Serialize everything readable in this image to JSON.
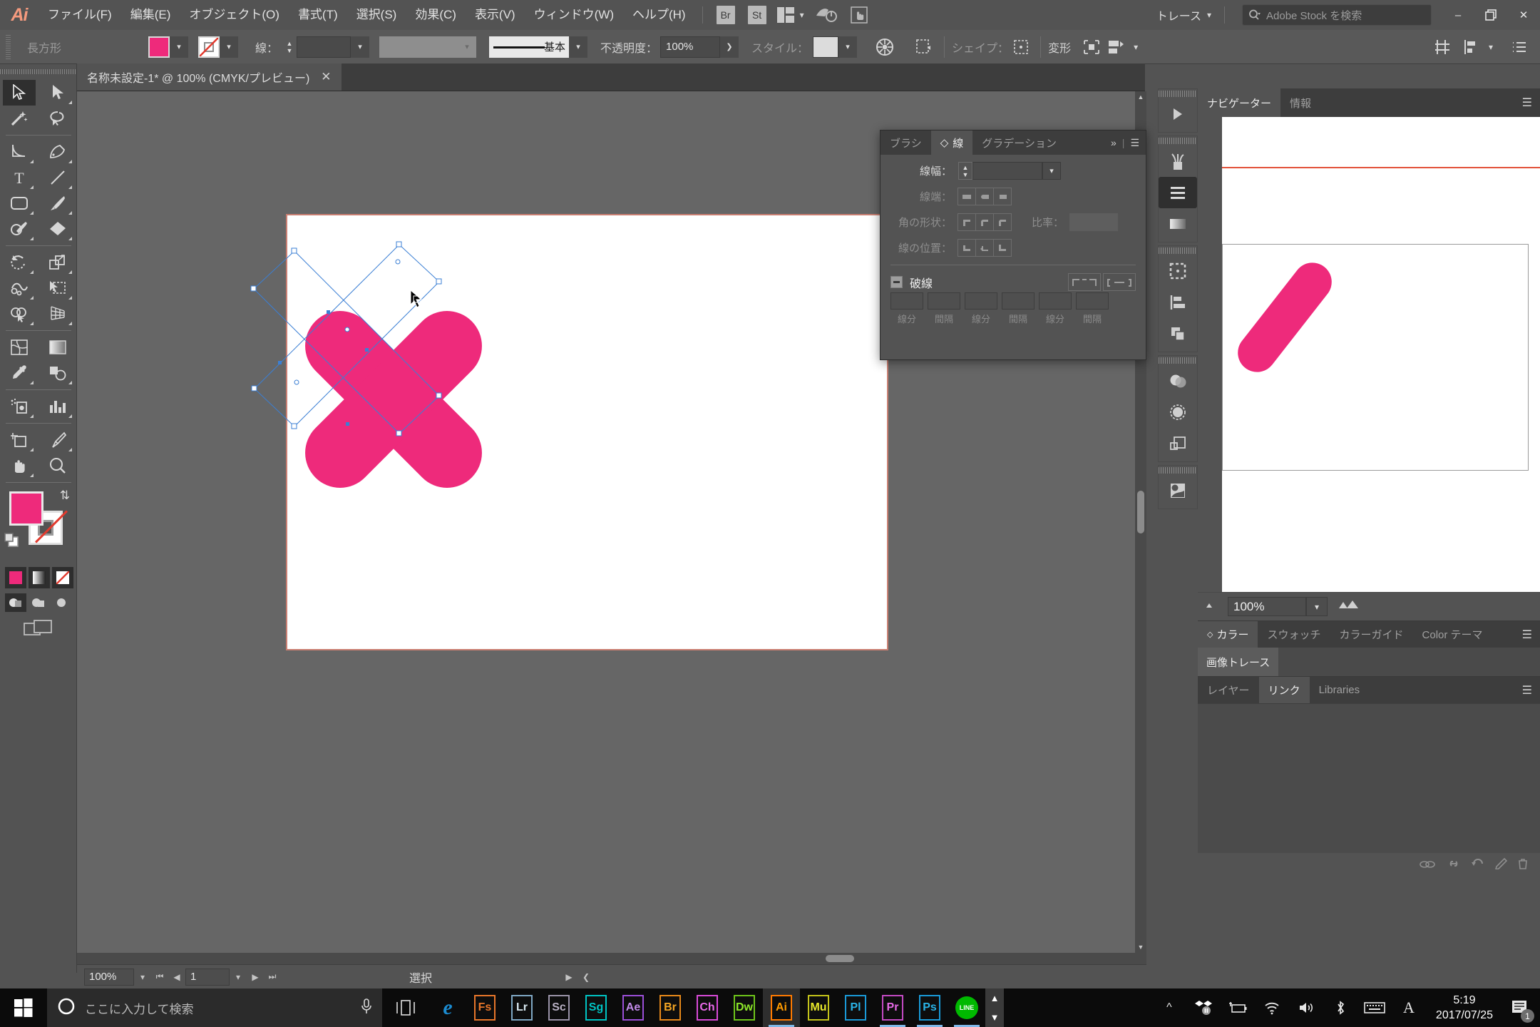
{
  "app": {
    "name": "Adobe Illustrator",
    "logo_text": "Ai",
    "workspace": "トレース",
    "stock_placeholder": "Adobe Stock を検索",
    "quick_buttons": [
      {
        "label": "Br",
        "name": "bridge-button"
      },
      {
        "label": "St",
        "name": "stock-button"
      }
    ]
  },
  "menu": {
    "items": [
      {
        "label": "ファイル(F)"
      },
      {
        "label": "編集(E)"
      },
      {
        "label": "オブジェクト(O)"
      },
      {
        "label": "書式(T)"
      },
      {
        "label": "選択(S)"
      },
      {
        "label": "効果(C)"
      },
      {
        "label": "表示(V)"
      },
      {
        "label": "ウィンドウ(W)"
      },
      {
        "label": "ヘルプ(H)"
      }
    ]
  },
  "window_buttons": {
    "minimize": "–",
    "restore": "❐",
    "close": "✕"
  },
  "control_bar": {
    "object_label": "長方形",
    "fill_color": "#ee2a7b",
    "stroke_label": "線：",
    "stroke_weight": "",
    "profile_label": "基本",
    "opacity_label": "不透明度：",
    "opacity_value": "100%",
    "style_label": "スタイル：",
    "shape_label": "シェイプ：",
    "transform_label": "変形"
  },
  "document": {
    "tab_title": "名称未設定-1* @ 100% (CMYK/プレビュー)",
    "close_glyph": "✕"
  },
  "toolbar": {
    "tools": [
      {
        "name": "selection-tool",
        "glyph": "selection",
        "selected": true
      },
      {
        "name": "direct-selection-tool",
        "glyph": "direct"
      },
      {
        "name": "magic-wand-tool",
        "glyph": "wand"
      },
      {
        "name": "lasso-tool",
        "glyph": "lasso"
      },
      {
        "name": "curvature-tool",
        "glyph": "curvature"
      },
      {
        "name": "pen-tool",
        "glyph": "pen"
      },
      {
        "name": "type-tool",
        "glyph": "type"
      },
      {
        "name": "line-segment-tool",
        "glyph": "line"
      },
      {
        "name": "rectangle-tool",
        "glyph": "rect"
      },
      {
        "name": "paintbrush-tool",
        "glyph": "brush"
      },
      {
        "name": "shaper-tool",
        "glyph": "shaper"
      },
      {
        "name": "eraser-tool",
        "glyph": "eraser"
      },
      {
        "name": "rotate-tool",
        "glyph": "rotate"
      },
      {
        "name": "scale-tool",
        "glyph": "scale"
      },
      {
        "name": "width-tool",
        "glyph": "width"
      },
      {
        "name": "free-transform-tool",
        "glyph": "freetransform"
      },
      {
        "name": "shape-builder-tool",
        "glyph": "shapebuilder"
      },
      {
        "name": "perspective-grid-tool",
        "glyph": "perspective"
      },
      {
        "name": "mesh-tool",
        "glyph": "mesh"
      },
      {
        "name": "gradient-tool",
        "glyph": "gradient"
      },
      {
        "name": "eyedropper-tool",
        "glyph": "eyedropper"
      },
      {
        "name": "blend-tool",
        "glyph": "blend"
      },
      {
        "name": "symbol-sprayer-tool",
        "glyph": "sprayer"
      },
      {
        "name": "column-graph-tool",
        "glyph": "graph"
      },
      {
        "name": "artboard-tool",
        "glyph": "artboard"
      },
      {
        "name": "slice-tool",
        "glyph": "slice"
      },
      {
        "name": "hand-tool",
        "glyph": "hand"
      },
      {
        "name": "zoom-tool",
        "glyph": "zoom"
      }
    ],
    "fill_color": "#ee2a7b",
    "stroke_color": "none"
  },
  "stroke_panel": {
    "tabs": [
      {
        "label": "ブラシ",
        "active": false
      },
      {
        "label": "線",
        "active": true
      },
      {
        "label": "グラデーション",
        "active": false
      }
    ],
    "collapse_glyph": "»",
    "rows": {
      "weight_label": "線幅：",
      "weight_value": "",
      "cap_label": "線端：",
      "corner_label": "角の形状：",
      "ratio_label": "比率：",
      "ratio_value": "",
      "align_label": "線の位置："
    },
    "dash": {
      "label": "破線",
      "fields": [
        {
          "caption": "線分",
          "value": ""
        },
        {
          "caption": "間隔",
          "value": ""
        },
        {
          "caption": "線分",
          "value": ""
        },
        {
          "caption": "間隔",
          "value": ""
        },
        {
          "caption": "線分",
          "value": ""
        },
        {
          "caption": "間隔",
          "value": ""
        }
      ]
    }
  },
  "right_panels": {
    "navigator": {
      "tabs": [
        {
          "label": "ナビゲーター",
          "active": true
        },
        {
          "label": "情報",
          "active": false
        }
      ],
      "zoom_value": "100%"
    },
    "color_group": {
      "tabs": [
        {
          "label": "カラー",
          "active": true
        },
        {
          "label": "スウォッチ",
          "active": false
        },
        {
          "label": "カラーガイド",
          "active": false
        },
        {
          "label": "Color テーマ",
          "active": false
        }
      ]
    },
    "image_trace": {
      "tab_label": "画像トレース"
    },
    "layers_group": {
      "tabs": [
        {
          "label": "レイヤー",
          "active": false
        },
        {
          "label": "リンク",
          "active": true
        },
        {
          "label": "Libraries",
          "active": false
        }
      ]
    }
  },
  "status_bar": {
    "zoom_value": "100%",
    "page_value": "1",
    "status_text": "選択"
  },
  "artwork": {
    "shape_fill": "#ee2a7b",
    "selection_color": "#3b7fd4",
    "artboard_border": "#c97f72"
  },
  "taskbar": {
    "search_placeholder": "ここに入力して検索",
    "apps": [
      {
        "label": "e",
        "name": "edge-icon",
        "color": "#1b8bd0",
        "border": "none"
      },
      {
        "label": "Fs",
        "name": "fuse-icon",
        "color": "#e8762a",
        "border": "#e8762a"
      },
      {
        "label": "Lr",
        "name": "lightroom-icon",
        "color": "#d8e8f0",
        "border": "#7fa8c4"
      },
      {
        "label": "Sc",
        "name": "scout-icon",
        "color": "#b9b1c4",
        "border": "#9a93a8"
      },
      {
        "label": "Sg",
        "name": "speedgrade-icon",
        "color": "#00c4c4",
        "border": "#00c4c4"
      },
      {
        "label": "Ae",
        "name": "aftereffects-icon",
        "color": "#c18ae8",
        "border": "#9b4fd8"
      },
      {
        "label": "Br",
        "name": "bridge-icon",
        "color": "#f5a623",
        "border": "#e8891a"
      },
      {
        "label": "Ch",
        "name": "characteranimator-icon",
        "color": "#e86ae8",
        "border": "#d84ad8"
      },
      {
        "label": "Dw",
        "name": "dreamweaver-icon",
        "color": "#8fe82a",
        "border": "#6ec41a"
      },
      {
        "label": "Ai",
        "name": "illustrator-icon",
        "color": "#ff9a00",
        "border": "#ff7a00",
        "active": true
      },
      {
        "label": "Mu",
        "name": "muse-icon",
        "color": "#e8e82a",
        "border": "#c4c41a"
      },
      {
        "label": "Pl",
        "name": "prelude-icon",
        "color": "#2ab4e8",
        "border": "#1a9ad8"
      },
      {
        "label": "Pr",
        "name": "premiere-icon",
        "color": "#e86ae8",
        "border": "#c44ac4"
      },
      {
        "label": "Ps",
        "name": "photoshop-icon",
        "color": "#2ab4e8",
        "border": "#1a9ad8"
      },
      {
        "label": "LINE",
        "name": "line-icon",
        "color": "#ffffff",
        "border": "#00b900"
      }
    ],
    "clock_time": "5:19",
    "clock_date": "2017/07/25",
    "notification_count": "1"
  }
}
